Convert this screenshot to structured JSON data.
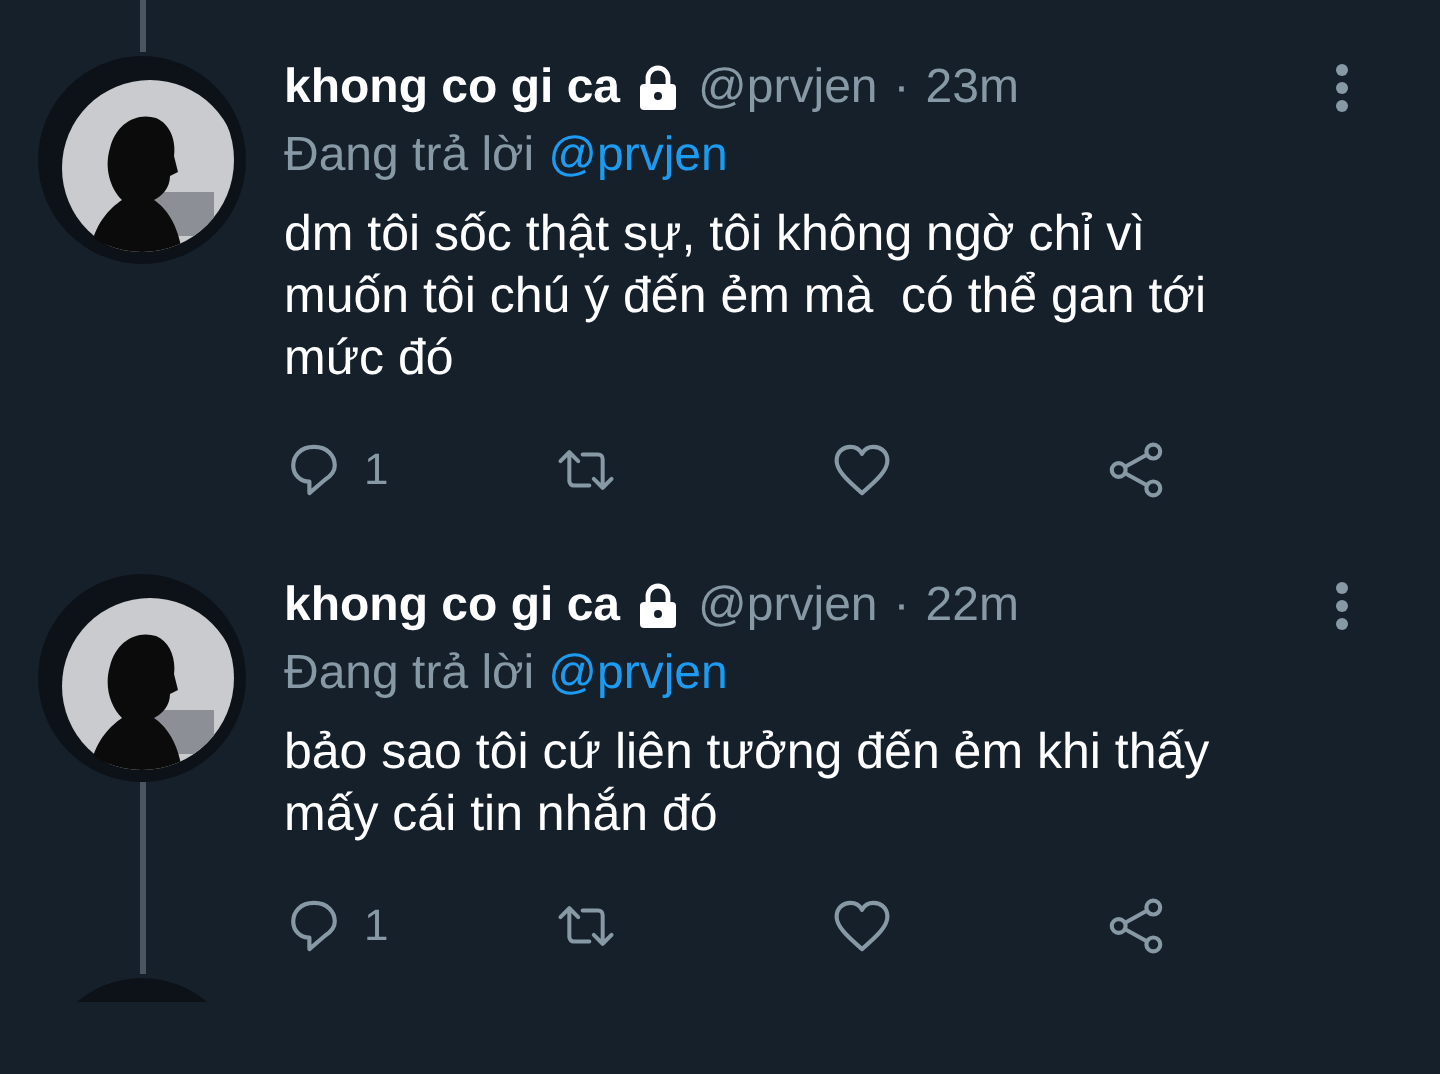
{
  "tweets": [
    {
      "name": "khong co gi ca",
      "protected": true,
      "handle": "@prvjen",
      "separator": "·",
      "time": "23m",
      "reply_prefix": "Đang trả lời",
      "reply_to": "@prvjen",
      "text": "dm tôi sốc thật sự, tôi không ngờ chỉ vì muốn tôi chú ý đến ẻm mà  có thể gan tới mức đó",
      "reply_count": "1",
      "thread_above": true,
      "thread_below": false
    },
    {
      "name": "khong co gi ca",
      "protected": true,
      "handle": "@prvjen",
      "separator": "·",
      "time": "22m",
      "reply_prefix": "Đang trả lời",
      "reply_to": "@prvjen",
      "text": "bảo sao tôi cứ liên tưởng đến ẻm khi thấy mấy cái tin nhắn đó",
      "reply_count": "1",
      "thread_above": false,
      "thread_below": true
    }
  ]
}
